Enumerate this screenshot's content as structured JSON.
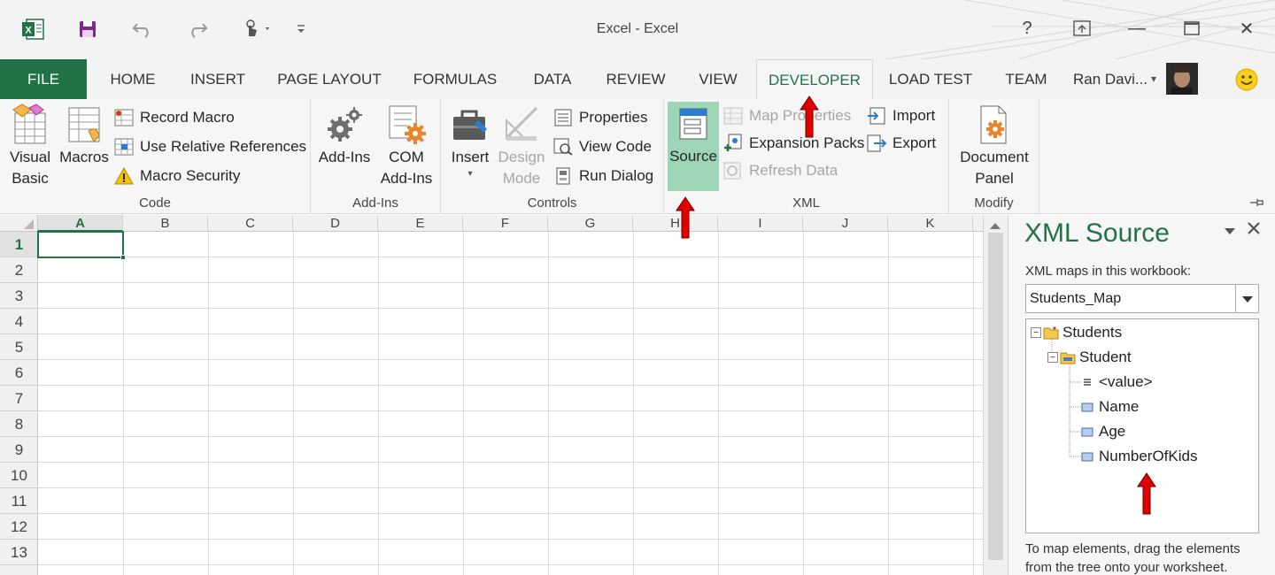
{
  "window": {
    "title": "Excel - Excel",
    "help": "?",
    "minimize": "—",
    "close": "✕"
  },
  "tabs": {
    "file": "FILE",
    "home": "HOME",
    "insert": "INSERT",
    "page_layout": "PAGE LAYOUT",
    "formulas": "FORMULAS",
    "data": "DATA",
    "review": "REVIEW",
    "view": "VIEW",
    "developer": "DEVELOPER",
    "load_test": "LOAD TEST",
    "team": "TEAM"
  },
  "user": {
    "name": "Ran Davi...",
    "dropdown": "▾"
  },
  "ribbon": {
    "code": {
      "label": "Code",
      "visual_basic_line1": "Visual",
      "visual_basic_line2": "Basic",
      "macros": "Macros",
      "record_macro": "Record Macro",
      "use_relative": "Use Relative References",
      "macro_security": "Macro Security"
    },
    "addins": {
      "label": "Add-Ins",
      "addins": "Add-Ins",
      "com_line1": "COM",
      "com_line2": "Add-Ins"
    },
    "controls": {
      "label": "Controls",
      "insert": "Insert",
      "design_line1": "Design",
      "design_line2": "Mode",
      "properties": "Properties",
      "view_code": "View Code",
      "run_dialog": "Run Dialog"
    },
    "xml": {
      "label": "XML",
      "source": "Source",
      "map_properties": "Map Properties",
      "expansion_packs": "Expansion Packs",
      "refresh_data": "Refresh Data",
      "import": "Import",
      "export": "Export"
    },
    "modify": {
      "label": "Modify",
      "doc_line1": "Document",
      "doc_line2": "Panel"
    }
  },
  "sheet": {
    "columns": [
      "A",
      "B",
      "C",
      "D",
      "E",
      "F",
      "G",
      "H",
      "I",
      "J",
      "K"
    ],
    "rows": [
      "1",
      "2",
      "3",
      "4",
      "5",
      "6",
      "7",
      "8",
      "9",
      "10",
      "11",
      "12",
      "13"
    ],
    "selected_cell": "A1"
  },
  "xml_source": {
    "title": "XML Source",
    "maps_label": "XML maps in this workbook:",
    "selected_map": "Students_Map",
    "tree": {
      "root": "Students",
      "child": "Student",
      "value": "<value>",
      "name": "Name",
      "age": "Age",
      "kids": "NumberOfKids"
    },
    "hint_line1": "To map elements, drag the elements",
    "hint_line2": "from the tree onto your worksheet."
  },
  "colors": {
    "accent": "#217346",
    "source_highlight": "#9fd5b7",
    "arrow_red": "#e00000"
  }
}
